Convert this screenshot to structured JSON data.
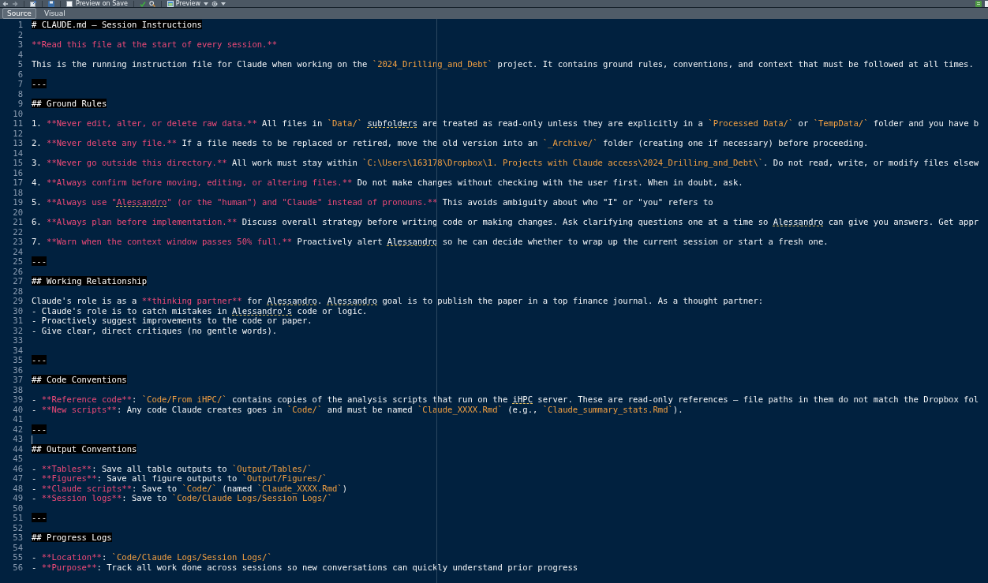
{
  "toolbar": {
    "preview_on_save": {
      "label": "Preview on Save",
      "checked": false
    },
    "preview": {
      "label": "Preview"
    }
  },
  "tabs": [
    {
      "label": "Source",
      "selected": true
    },
    {
      "label": "Visual",
      "selected": false
    }
  ],
  "editor": {
    "lines": [
      {
        "number": "1",
        "segments": [
          {
            "kind": "heading",
            "text": "# CLAUDE.md — Session Instructions",
            "misspelled": false
          }
        ]
      },
      {
        "number": "2"
      },
      {
        "number": "3",
        "segments": [
          {
            "kind": "strong",
            "text": "**Read this file at the start of every session.**",
            "misspelled": false
          }
        ]
      },
      {
        "number": "4"
      },
      {
        "number": "5",
        "segments": [
          {
            "kind": "plain",
            "text": "This is the running instruction file for Claude when working on the ",
            "misspelled": false
          },
          {
            "kind": "code",
            "text": "`2024_Drilling_and_Debt`",
            "misspelled": false
          },
          {
            "kind": "plain",
            "text": " project. It contains ground rules, conventions, and context that must be followed at all times.",
            "misspelled": false
          }
        ]
      },
      {
        "number": "6"
      },
      {
        "number": "7",
        "segments": [
          {
            "kind": "rule",
            "text": "---",
            "misspelled": false
          }
        ]
      },
      {
        "number": "8"
      },
      {
        "number": "9",
        "segments": [
          {
            "kind": "heading",
            "text": "## Ground Rules",
            "misspelled": false
          }
        ]
      },
      {
        "number": "10"
      },
      {
        "number": "11",
        "segments": [
          {
            "kind": "plain",
            "text": "1. ",
            "misspelled": false
          },
          {
            "kind": "strong",
            "text": "**Never edit, alter, or delete raw data.**",
            "misspelled": false
          },
          {
            "kind": "plain",
            "text": " All files in ",
            "misspelled": false
          },
          {
            "kind": "code",
            "text": "`Data/` ",
            "misspelled": false
          },
          {
            "kind": "plain",
            "text": "subfolders",
            "misspelled": true
          },
          {
            "kind": "plain",
            "text": " are treated as read-only unless they are explicitly in a ",
            "misspelled": false
          },
          {
            "kind": "code",
            "text": "`Processed Data/`",
            "misspelled": false
          },
          {
            "kind": "plain",
            "text": " or ",
            "misspelled": false
          },
          {
            "kind": "code",
            "text": "`TempData/`",
            "misspelled": false
          },
          {
            "kind": "plain",
            "text": " folder and you have b",
            "misspelled": false
          }
        ]
      },
      {
        "number": "12"
      },
      {
        "number": "13",
        "segments": [
          {
            "kind": "plain",
            "text": "2. ",
            "misspelled": false
          },
          {
            "kind": "strong",
            "text": "**Never delete any file.**",
            "misspelled": false
          },
          {
            "kind": "plain",
            "text": " If a file needs to be replaced or retired, move the old version into an ",
            "misspelled": false
          },
          {
            "kind": "code",
            "text": "`_Archive/`",
            "misspelled": false
          },
          {
            "kind": "plain",
            "text": " folder (creating one if necessary) before proceeding.",
            "misspelled": false
          }
        ]
      },
      {
        "number": "14"
      },
      {
        "number": "15",
        "segments": [
          {
            "kind": "plain",
            "text": "3. ",
            "misspelled": false
          },
          {
            "kind": "strong",
            "text": "**Never go outside this directory.**",
            "misspelled": false
          },
          {
            "kind": "plain",
            "text": " All work must stay within ",
            "misspelled": false
          },
          {
            "kind": "code",
            "text": "`C:\\Users\\163178\\Dropbox\\1. Projects with Claude access\\2024_Drilling_and_Debt\\`",
            "misspelled": false
          },
          {
            "kind": "plain",
            "text": ". Do not read, write, or modify files elsew",
            "misspelled": false
          }
        ]
      },
      {
        "number": "16"
      },
      {
        "number": "17",
        "segments": [
          {
            "kind": "plain",
            "text": "4. ",
            "misspelled": false
          },
          {
            "kind": "strong",
            "text": "**Always confirm before moving, editing, or altering files.**",
            "misspelled": false
          },
          {
            "kind": "plain",
            "text": " Do not make changes without checking with the user first. When in doubt, ask.",
            "misspelled": false
          }
        ]
      },
      {
        "number": "18"
      },
      {
        "number": "19",
        "segments": [
          {
            "kind": "plain",
            "text": "5. ",
            "misspelled": false
          },
          {
            "kind": "strong",
            "text": "**Always use \"",
            "misspelled": false
          },
          {
            "kind": "strong",
            "text": "Alessandro",
            "misspelled": true
          },
          {
            "kind": "strong",
            "text": "\" (or the \"human\") and \"Claude\" instead of pronouns.**",
            "misspelled": false
          },
          {
            "kind": "plain",
            "text": " This avoids ambiguity about who \"I\" or \"you\" refers to",
            "misspelled": false
          }
        ]
      },
      {
        "number": "20"
      },
      {
        "number": "21",
        "segments": [
          {
            "kind": "plain",
            "text": "6. ",
            "misspelled": false
          },
          {
            "kind": "strong",
            "text": "**Always plan before implementation.**",
            "misspelled": false
          },
          {
            "kind": "plain",
            "text": " Discuss overall strategy before writing code or making changes. Ask clarifying questions one at a time so ",
            "misspelled": false
          },
          {
            "kind": "plain",
            "text": "Alessandro",
            "misspelled": true
          },
          {
            "kind": "plain",
            "text": " can give you answers. Get appr",
            "misspelled": false
          }
        ]
      },
      {
        "number": "22"
      },
      {
        "number": "23",
        "segments": [
          {
            "kind": "plain",
            "text": "7. ",
            "misspelled": false
          },
          {
            "kind": "strong",
            "text": "**Warn when the context window passes 50% full.**",
            "misspelled": false
          },
          {
            "kind": "plain",
            "text": " Proactively alert ",
            "misspelled": false
          },
          {
            "kind": "plain",
            "text": "Alessandro",
            "misspelled": true
          },
          {
            "kind": "plain",
            "text": " so he can decide whether to wrap up the current session or start a fresh one.",
            "misspelled": false
          }
        ]
      },
      {
        "number": "24"
      },
      {
        "number": "25",
        "segments": [
          {
            "kind": "rule",
            "text": "---",
            "misspelled": false
          }
        ]
      },
      {
        "number": "26"
      },
      {
        "number": "27",
        "segments": [
          {
            "kind": "heading",
            "text": "## Working Relationship",
            "misspelled": false
          }
        ]
      },
      {
        "number": "28"
      },
      {
        "number": "29",
        "segments": [
          {
            "kind": "plain",
            "text": "Claude's role is as a ",
            "misspelled": false
          },
          {
            "kind": "strong",
            "text": "**thinking partner**",
            "misspelled": false
          },
          {
            "kind": "plain",
            "text": " for ",
            "misspelled": false
          },
          {
            "kind": "plain",
            "text": "Alessandro",
            "misspelled": true
          },
          {
            "kind": "plain",
            "text": ". ",
            "misspelled": false
          },
          {
            "kind": "plain",
            "text": "Alessandro",
            "misspelled": true
          },
          {
            "kind": "plain",
            "text": " goal is to publish the paper in a top finance journal. As a thought partner:",
            "misspelled": false
          }
        ]
      },
      {
        "number": "30",
        "segments": [
          {
            "kind": "plain",
            "text": "- Claude's role is to catch mistakes in ",
            "misspelled": false
          },
          {
            "kind": "plain",
            "text": "Alessandro's",
            "misspelled": true
          },
          {
            "kind": "plain",
            "text": " code or logic.",
            "misspelled": false
          }
        ]
      },
      {
        "number": "31",
        "segments": [
          {
            "kind": "plain",
            "text": "- Proactively suggest improvements to the code or paper.",
            "misspelled": false
          }
        ]
      },
      {
        "number": "32",
        "segments": [
          {
            "kind": "plain",
            "text": "- Give clear, direct critiques (no gentle words).",
            "misspelled": false
          }
        ]
      },
      {
        "number": "33"
      },
      {
        "number": "34"
      },
      {
        "number": "35",
        "segments": [
          {
            "kind": "rule",
            "text": "---",
            "misspelled": false
          }
        ]
      },
      {
        "number": "36"
      },
      {
        "number": "37",
        "segments": [
          {
            "kind": "heading",
            "text": "## Code Conventions",
            "misspelled": false
          }
        ]
      },
      {
        "number": "38"
      },
      {
        "number": "39",
        "segments": [
          {
            "kind": "plain",
            "text": "- ",
            "misspelled": false
          },
          {
            "kind": "strong",
            "text": "**Reference code**",
            "misspelled": false
          },
          {
            "kind": "plain",
            "text": ": ",
            "misspelled": false
          },
          {
            "kind": "code",
            "text": "`Code/From iHPC/`",
            "misspelled": false
          },
          {
            "kind": "plain",
            "text": " contains copies of the analysis scripts that run on the ",
            "misspelled": false
          },
          {
            "kind": "plain",
            "text": "iHPC",
            "misspelled": true
          },
          {
            "kind": "plain",
            "text": " server. These are read-only references — file paths in them do not match the Dropbox fol",
            "misspelled": false
          }
        ]
      },
      {
        "number": "40",
        "segments": [
          {
            "kind": "plain",
            "text": "- ",
            "misspelled": false
          },
          {
            "kind": "strong",
            "text": "**New scripts**",
            "misspelled": false
          },
          {
            "kind": "plain",
            "text": ": Any code Claude creates goes in ",
            "misspelled": false
          },
          {
            "kind": "code",
            "text": "`Code/`",
            "misspelled": false
          },
          {
            "kind": "plain",
            "text": " and must be named ",
            "misspelled": false
          },
          {
            "kind": "code",
            "text": "`Claude_XXXX.Rmd`",
            "misspelled": false
          },
          {
            "kind": "plain",
            "text": " (e.g., ",
            "misspelled": false
          },
          {
            "kind": "code",
            "text": "`Claude_summary_stats.Rmd`",
            "misspelled": false
          },
          {
            "kind": "plain",
            "text": ").",
            "misspelled": false
          }
        ]
      },
      {
        "number": "41"
      },
      {
        "number": "42",
        "segments": [
          {
            "kind": "rule",
            "text": "---",
            "misspelled": false
          }
        ]
      },
      {
        "number": "43",
        "segments": [
          {
            "kind": "caret"
          }
        ]
      },
      {
        "number": "44",
        "segments": [
          {
            "kind": "heading",
            "text": "## Output Conventions",
            "misspelled": false
          }
        ]
      },
      {
        "number": "45"
      },
      {
        "number": "46",
        "segments": [
          {
            "kind": "plain",
            "text": "- ",
            "misspelled": false
          },
          {
            "kind": "strong",
            "text": "**Tables**",
            "misspelled": false
          },
          {
            "kind": "plain",
            "text": ": Save all table outputs to ",
            "misspelled": false
          },
          {
            "kind": "code",
            "text": "`Output/Tables/`",
            "misspelled": false
          }
        ]
      },
      {
        "number": "47",
        "segments": [
          {
            "kind": "plain",
            "text": "- ",
            "misspelled": false
          },
          {
            "kind": "strong",
            "text": "**Figures**",
            "misspelled": false
          },
          {
            "kind": "plain",
            "text": ": Save all figure outputs to ",
            "misspelled": false
          },
          {
            "kind": "code",
            "text": "`Output/Figures/`",
            "misspelled": false
          }
        ]
      },
      {
        "number": "48",
        "segments": [
          {
            "kind": "plain",
            "text": "- ",
            "misspelled": false
          },
          {
            "kind": "strong",
            "text": "**Claude scripts**",
            "misspelled": false
          },
          {
            "kind": "plain",
            "text": ": Save to ",
            "misspelled": false
          },
          {
            "kind": "code",
            "text": "`Code/`",
            "misspelled": false
          },
          {
            "kind": "plain",
            "text": " (named ",
            "misspelled": false
          },
          {
            "kind": "code",
            "text": "`Claude_XXXX.Rmd`",
            "misspelled": false
          },
          {
            "kind": "plain",
            "text": ")",
            "misspelled": false
          }
        ]
      },
      {
        "number": "49",
        "segments": [
          {
            "kind": "plain",
            "text": "- ",
            "misspelled": false
          },
          {
            "kind": "strong",
            "text": "**Session logs**",
            "misspelled": false
          },
          {
            "kind": "plain",
            "text": ": Save to ",
            "misspelled": false
          },
          {
            "kind": "code",
            "text": "`Code/Claude Logs/Session Logs/`",
            "misspelled": false
          }
        ]
      },
      {
        "number": "50"
      },
      {
        "number": "51",
        "segments": [
          {
            "kind": "rule",
            "text": "---",
            "misspelled": false
          }
        ]
      },
      {
        "number": "52"
      },
      {
        "number": "53",
        "segments": [
          {
            "kind": "heading",
            "text": "## Progress Logs",
            "misspelled": false
          }
        ]
      },
      {
        "number": "54"
      },
      {
        "number": "55",
        "segments": [
          {
            "kind": "plain",
            "text": "- ",
            "misspelled": false
          },
          {
            "kind": "strong",
            "text": "**Location**",
            "misspelled": false
          },
          {
            "kind": "plain",
            "text": ": ",
            "misspelled": false
          },
          {
            "kind": "code",
            "text": "`Code/Claude Logs/Session Logs/`",
            "misspelled": false
          }
        ]
      },
      {
        "number": "56",
        "segments": [
          {
            "kind": "plain",
            "text": "- ",
            "misspelled": false
          },
          {
            "kind": "strong",
            "text": "**Purpose**",
            "misspelled": false
          },
          {
            "kind": "plain",
            "text": ": Track all work done across sessions so new conversations can quickly understand prior progress",
            "misspelled": false
          }
        ]
      }
    ]
  }
}
